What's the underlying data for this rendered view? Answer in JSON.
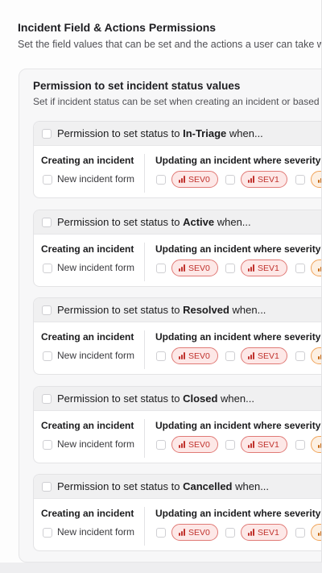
{
  "page": {
    "title": "Incident Field & Actions Permissions",
    "subtitle": "Set the field values that can be set and the actions a user can take when c"
  },
  "status_section": {
    "title": "Permission to set incident status values",
    "subtitle": "Set if incident status can be set when creating an incident or based on"
  },
  "permissions": [
    {
      "prefix": "Permission to set status to ",
      "status": "In-Triage",
      "suffix": " when...",
      "create_title": "Creating an incident",
      "create_option": "New incident form",
      "update_title": "Updating an incident where severity is...",
      "severities": [
        "SEV0",
        "SEV1",
        ""
      ]
    },
    {
      "prefix": "Permission to set status to ",
      "status": "Active",
      "suffix": " when...",
      "create_title": "Creating an incident",
      "create_option": "New incident form",
      "update_title": "Updating an incident where severity is...",
      "severities": [
        "SEV0",
        "SEV1",
        ""
      ]
    },
    {
      "prefix": "Permission to set status to ",
      "status": "Resolved",
      "suffix": " when...",
      "create_title": "Creating an incident",
      "create_option": "New incident form",
      "update_title": "Updating an incident where severity is...",
      "severities": [
        "SEV0",
        "SEV1",
        ""
      ]
    },
    {
      "prefix": "Permission to set status to ",
      "status": "Closed",
      "suffix": " when...",
      "create_title": "Creating an incident",
      "create_option": "New incident form",
      "update_title": "Updating an incident where severity is...",
      "severities": [
        "SEV0",
        "SEV1",
        ""
      ]
    },
    {
      "prefix": "Permission to set status to ",
      "status": "Cancelled",
      "suffix": " when...",
      "create_title": "Creating an incident",
      "create_option": "New incident form",
      "update_title": "Updating an incident where severity is...",
      "severities": [
        "SEV0",
        "SEV1",
        ""
      ]
    }
  ],
  "icons": {
    "severity": "signal-bars-icon",
    "checkbox": "checkbox-unchecked"
  },
  "colors": {
    "sev_red_text": "#c0322d",
    "sev_red_bg": "#fde8e7",
    "sev_red_border": "#e07a76",
    "sev_orange_text": "#c66712",
    "sev_orange_bg": "#fdf0e2",
    "sev_orange_border": "#f0a35a"
  }
}
